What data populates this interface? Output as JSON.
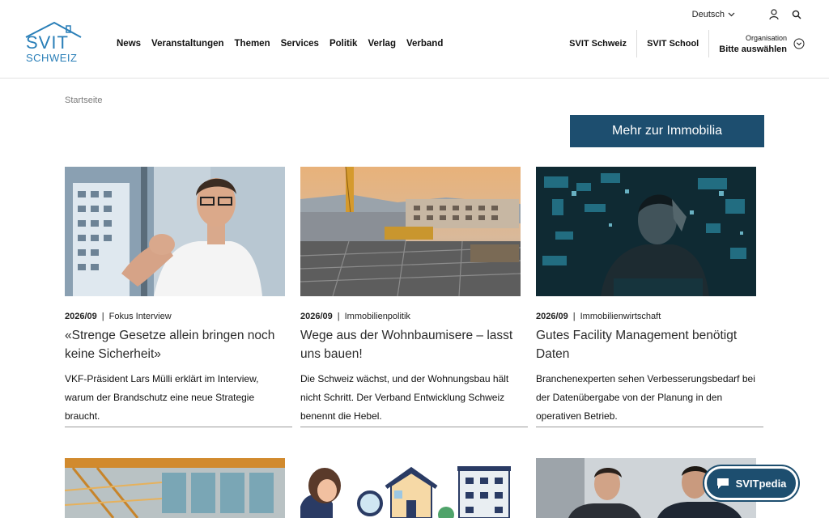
{
  "brand": {
    "logo_line1": "SVIT",
    "logo_line2": "SCHWEIZ",
    "color": "#2a7fb8"
  },
  "mainnav": [
    "News",
    "Veranstaltungen",
    "Themen",
    "Services",
    "Politik",
    "Verlag",
    "Verband"
  ],
  "topbar": {
    "language": "Deutsch",
    "user_icon": "user-icon",
    "search_icon": "search-icon"
  },
  "rightnav": {
    "links": [
      "SVIT Schweiz",
      "SVIT School"
    ],
    "org_label": "Organisation",
    "org_value": "Bitte auswählen"
  },
  "breadcrumb": "Startseite",
  "cta": {
    "label": "Mehr zur Immobilia",
    "color": "#1d4e6f"
  },
  "articles": [
    {
      "issue": "2026/09",
      "category": "Fokus Interview",
      "title": "«Strenge Gesetze allein bringen noch keine Sicherheit»",
      "description": "VKF-Präsident Lars Mülli erklärt im Interview, warum der Brandschutz eine neue Strategie braucht.",
      "image": "portrait of man gesturing in office"
    },
    {
      "issue": "2026/09",
      "category": "Immobilienpolitik",
      "title": "Wege aus der Wohnbaumisere – lasst uns bauen!",
      "description": "Die Schweiz wächst, und der Wohnungsbau hält nicht Schritt. Der Verband Entwicklung Schweiz benennt die Hebel.",
      "image": "construction site with crane at dusk"
    },
    {
      "issue": "2026/09",
      "category": "Immobilienwirtschaft",
      "title": "Gutes Facility Management benötigt Daten",
      "description": "Branchenexperten sehen Verbesserungsbedarf bei der Datenübergabe von der Planung in den operativen Betrieb.",
      "image": "stressed man with digital data overlay"
    }
  ],
  "chat_widget": {
    "label": "SVITpedia",
    "icon": "chat-icon"
  }
}
